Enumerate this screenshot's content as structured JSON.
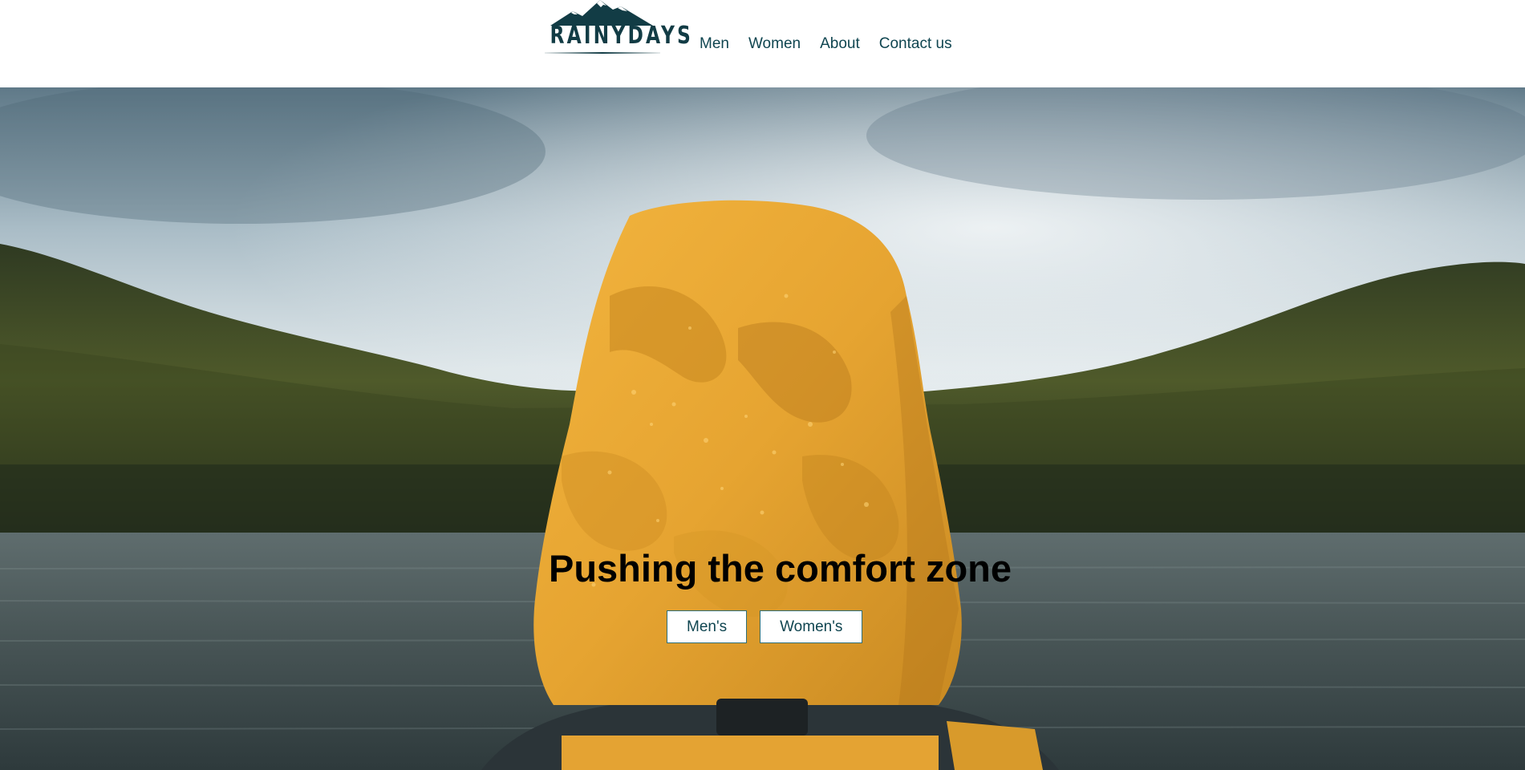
{
  "header": {
    "logo_text": "RAINYDAYS",
    "nav": [
      {
        "label": "Men"
      },
      {
        "label": "Women"
      },
      {
        "label": "About"
      },
      {
        "label": "Contact us"
      }
    ]
  },
  "hero": {
    "title": "Pushing the comfort zone",
    "buttons": [
      {
        "label": "Men's"
      },
      {
        "label": "Women's"
      }
    ]
  },
  "colors": {
    "brand": "#123c45",
    "nav_text": "#0f4550",
    "button_border": "#2f6f78",
    "jacket": "#e9a838"
  },
  "icons": {
    "logo_mark": "mountain-icon"
  }
}
